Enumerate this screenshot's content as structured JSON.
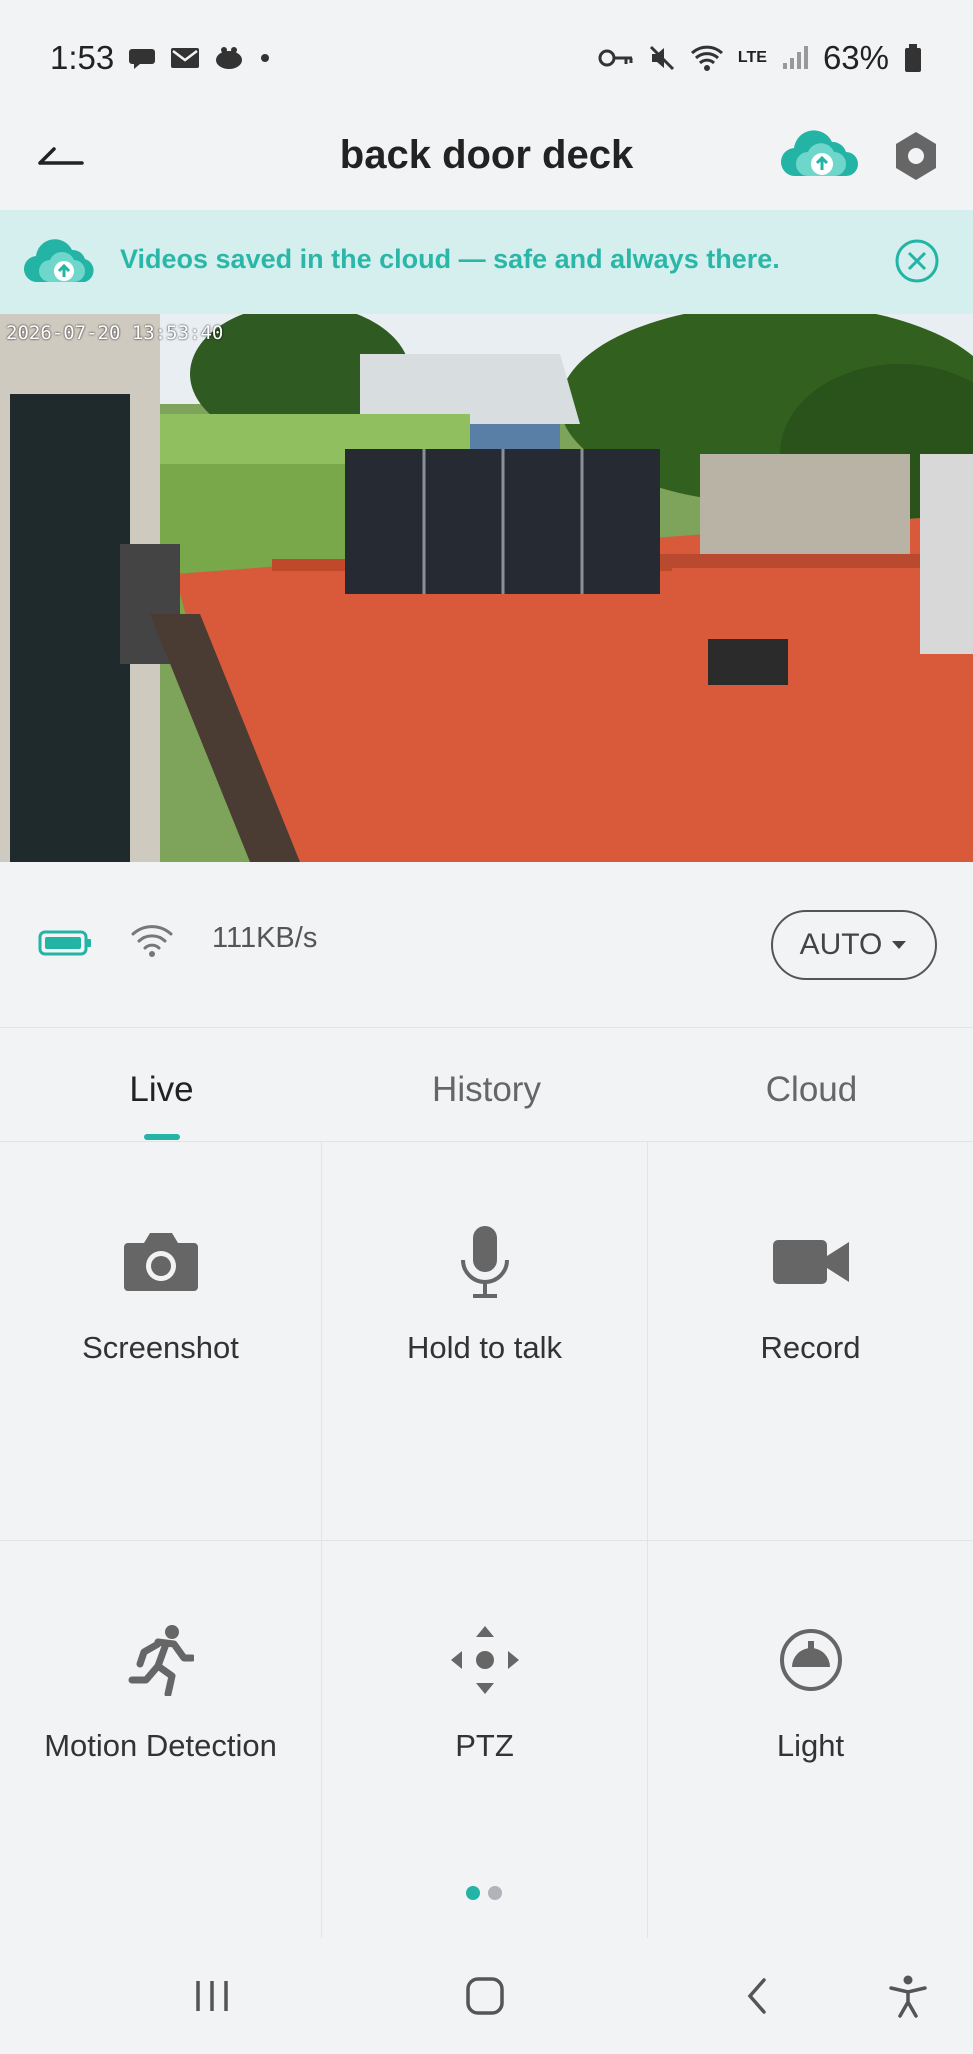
{
  "status_bar": {
    "time": "1:53",
    "battery": "63%",
    "left_icons": [
      "chat-icon",
      "mail-icon",
      "app-icon",
      "dot-icon"
    ],
    "right_icons": [
      "key-icon",
      "mute-icon",
      "wifi-icon",
      "lte-icon",
      "signal-icon",
      "battery-icon"
    ],
    "lte_label": "LTE"
  },
  "app_bar": {
    "title": "back door deck",
    "accent": "#23b4a6"
  },
  "banner": {
    "text": "Videos saved in the cloud — safe and always there.",
    "background": "#d5efee",
    "text_color": "#2bb7a8"
  },
  "video": {
    "timestamp": "2026-07-20 13:53:40"
  },
  "info_row": {
    "speed": "111KB/s",
    "quality": "AUTO"
  },
  "tabs": [
    {
      "label": "Live",
      "active": true
    },
    {
      "label": "History",
      "active": false
    },
    {
      "label": "Cloud",
      "active": false
    }
  ],
  "actions": [
    {
      "label": "Screenshot",
      "icon": "camera-icon"
    },
    {
      "label": "Hold to talk",
      "icon": "microphone-icon"
    },
    {
      "label": "Record",
      "icon": "video-camera-icon"
    },
    {
      "label": "Motion Detection",
      "icon": "running-person-icon"
    },
    {
      "label": "PTZ",
      "icon": "ptz-arrows-icon"
    },
    {
      "label": "Light",
      "icon": "lamp-icon"
    }
  ],
  "pager": {
    "pages": 2,
    "current": 1
  },
  "nav_bar": {
    "icons": [
      "recent-apps-icon",
      "home-icon",
      "back-icon",
      "accessibility-icon"
    ]
  }
}
